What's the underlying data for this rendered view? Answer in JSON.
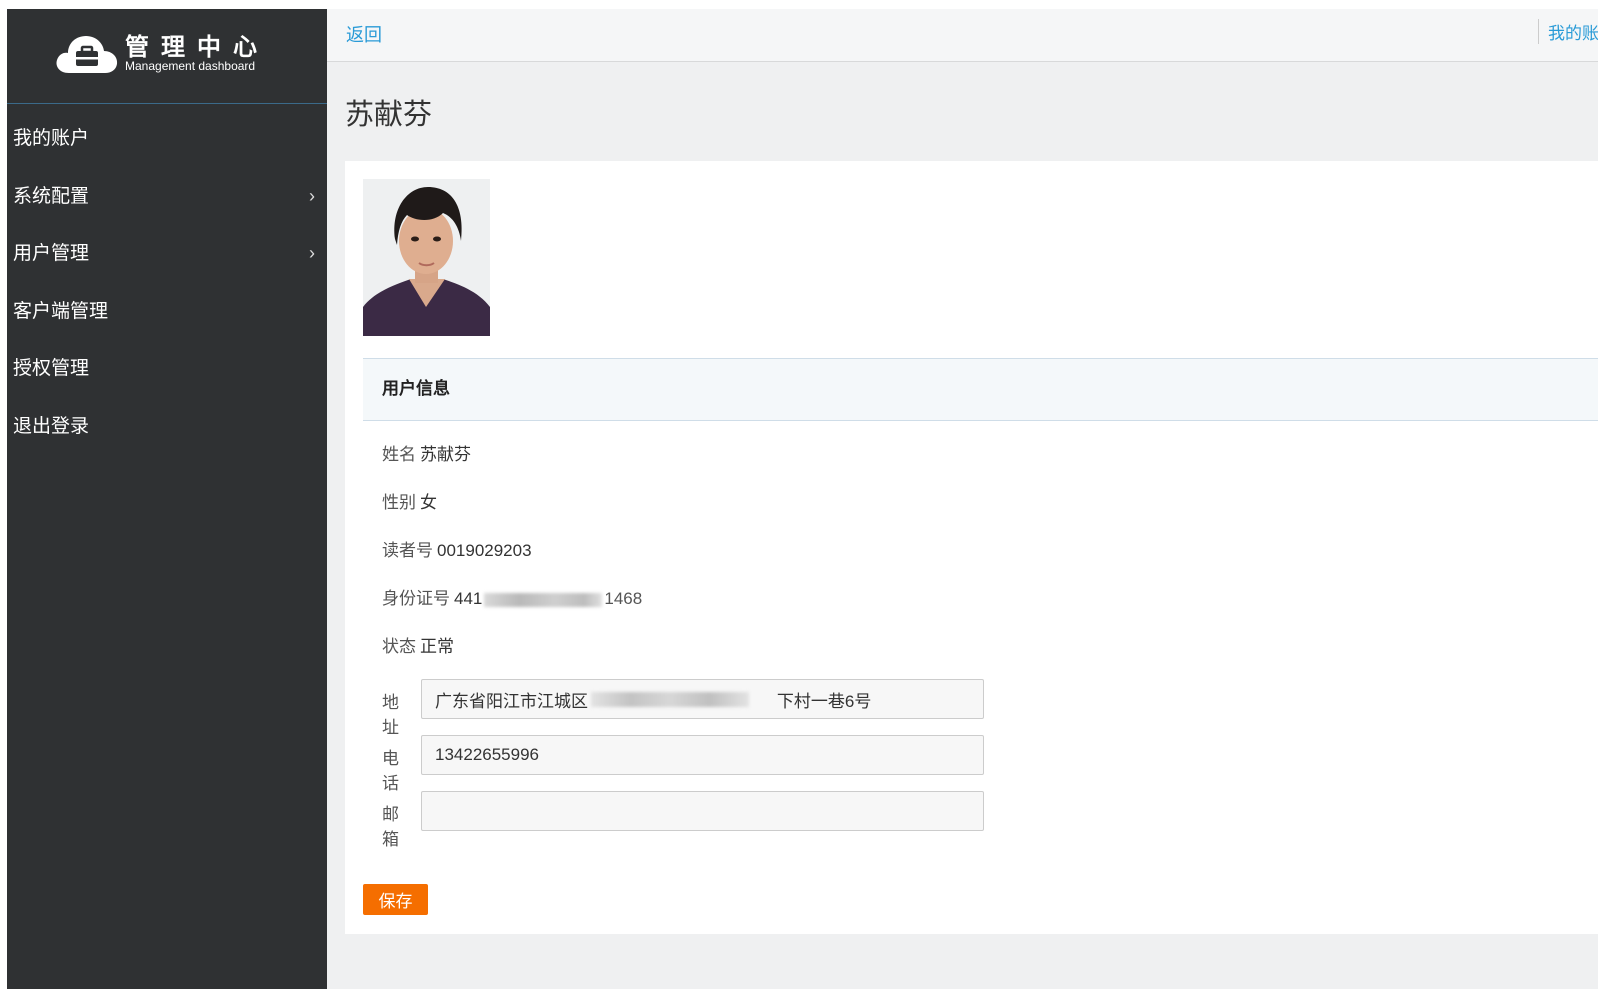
{
  "brand": {
    "title_cn": "管理中心",
    "subtitle_en": "Management dashboard"
  },
  "sidebar": {
    "items": [
      {
        "label": "我的账户",
        "has_submenu": false
      },
      {
        "label": "系统配置",
        "has_submenu": true
      },
      {
        "label": "用户管理",
        "has_submenu": true
      },
      {
        "label": "客户端管理",
        "has_submenu": false
      },
      {
        "label": "授权管理",
        "has_submenu": false
      },
      {
        "label": "退出登录",
        "has_submenu": false
      }
    ],
    "chevron": "›"
  },
  "topbar": {
    "back_label": "返回",
    "account_label": "我的账户"
  },
  "page": {
    "title": "苏献芬"
  },
  "user_info": {
    "header": "用户信息",
    "name_label": "姓名",
    "name_value": "苏献芬",
    "gender_label": "性别",
    "gender_value": "女",
    "reader_no_label": "读者号",
    "reader_no_value": "0019029203",
    "id_label": "身份证号",
    "id_prefix": "441",
    "id_suffix": "1468",
    "status_label": "状态",
    "status_value": "正常"
  },
  "form": {
    "address_label": "地址",
    "address_value": "广东省阳江市江城区                                        下村一巷6号",
    "phone_label": "电话",
    "phone_value": "13422655996",
    "email_label": "邮箱",
    "email_value": "",
    "save_label": "保存"
  },
  "colors": {
    "sidebar_bg": "#2f3133",
    "link": "#2a9bd7",
    "save_button": "#f56e00"
  },
  "icons": {
    "logo": "cloud-briefcase-icon",
    "submenu": "chevron-right-icon"
  }
}
